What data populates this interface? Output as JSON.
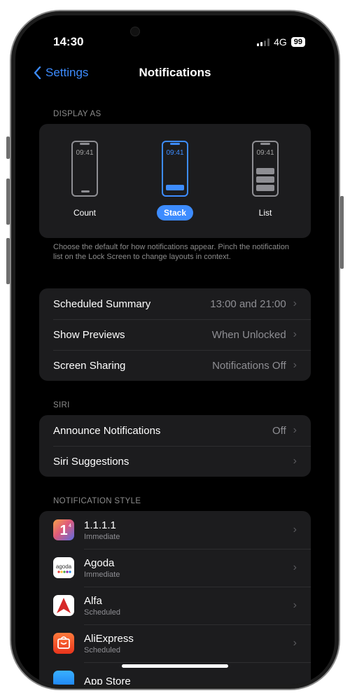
{
  "status": {
    "time": "14:30",
    "network": "4G",
    "battery": "99"
  },
  "nav": {
    "back_label": "Settings",
    "title": "Notifications"
  },
  "display_as": {
    "section_label": "DISPLAY AS",
    "clock": "09:41",
    "options": [
      {
        "label": "Count",
        "selected": false
      },
      {
        "label": "Stack",
        "selected": true
      },
      {
        "label": "List",
        "selected": false
      }
    ],
    "footnote": "Choose the default for how notifications appear. Pinch the notification list on the Lock Screen to change layouts in context."
  },
  "general": [
    {
      "label": "Scheduled Summary",
      "value": "13:00 and 21:00"
    },
    {
      "label": "Show Previews",
      "value": "When Unlocked"
    },
    {
      "label": "Screen Sharing",
      "value": "Notifications Off"
    }
  ],
  "siri": {
    "section_label": "SIRI",
    "rows": [
      {
        "label": "Announce Notifications",
        "value": "Off"
      },
      {
        "label": "Siri Suggestions",
        "value": ""
      }
    ]
  },
  "notification_style": {
    "section_label": "NOTIFICATION STYLE",
    "apps": [
      {
        "name": "1.1.1.1",
        "style": "Immediate",
        "icon": "1111-icon"
      },
      {
        "name": "Agoda",
        "style": "Immediate",
        "icon": "agoda-icon"
      },
      {
        "name": "Alfa",
        "style": "Scheduled",
        "icon": "alfa-icon"
      },
      {
        "name": "AliExpress",
        "style": "Scheduled",
        "icon": "aliexpress-icon"
      },
      {
        "name": "App Store",
        "style": "",
        "icon": "app-store-icon"
      }
    ]
  },
  "colors": {
    "accent": "#3d8cff",
    "background": "#000000",
    "card": "#1c1c1e",
    "secondary_text": "#8e8e93"
  }
}
